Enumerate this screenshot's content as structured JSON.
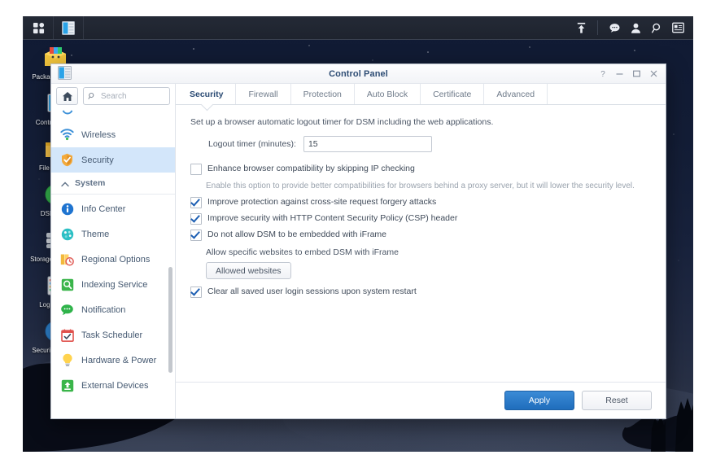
{
  "taskbar": {
    "left_items": [
      {
        "name": "app-menu",
        "icon": "grid-icon"
      },
      {
        "name": "control-panel-task",
        "icon": "control-panel-icon"
      }
    ],
    "right_items": [
      {
        "name": "upload-queue",
        "icon": "upload-icon"
      },
      {
        "name": "notifications",
        "icon": "chat-bubble-icon"
      },
      {
        "name": "user-options",
        "icon": "person-icon"
      },
      {
        "name": "search",
        "icon": "search-icon"
      },
      {
        "name": "widgets",
        "icon": "widget-icon"
      }
    ]
  },
  "desktop_icons": [
    {
      "label": "Package Center",
      "icon": "package-center-icon"
    },
    {
      "label": "Control Panel",
      "icon": "control-panel-icon"
    },
    {
      "label": "File Station",
      "icon": "file-station-icon"
    },
    {
      "label": "DSM Help",
      "icon": "dsm-help-icon"
    },
    {
      "label": "Storage Manager",
      "icon": "storage-manager-icon"
    },
    {
      "label": "Log Center",
      "icon": "log-center-icon"
    },
    {
      "label": "Security Advisor",
      "icon": "security-advisor-icon"
    }
  ],
  "window": {
    "title": "Control Panel",
    "app_icon": "control-panel-icon",
    "controls": [
      {
        "name": "help-button",
        "glyph": "?"
      },
      {
        "name": "minimize-button",
        "glyph": "–"
      },
      {
        "name": "maximize-button",
        "glyph": "□"
      },
      {
        "name": "close-button",
        "glyph": "×"
      }
    ]
  },
  "sidebar": {
    "home_icon": "home-icon",
    "search": {
      "placeholder": "Search",
      "value": "",
      "icon": "search-icon"
    },
    "partial_top_item": {
      "label": "",
      "icon": "network-icon"
    },
    "items": [
      {
        "label": "Wireless",
        "icon": "wireless-icon",
        "selected": false
      },
      {
        "label": "Security",
        "icon": "shield-icon",
        "selected": true
      }
    ],
    "group": {
      "label": "System",
      "icon": "chevron-up-icon",
      "expanded": true
    },
    "system_items": [
      {
        "label": "Info Center",
        "icon": "info-icon"
      },
      {
        "label": "Theme",
        "icon": "palette-icon"
      },
      {
        "label": "Regional Options",
        "icon": "regional-options-icon"
      },
      {
        "label": "Indexing Service",
        "icon": "indexing-service-icon"
      },
      {
        "label": "Notification",
        "icon": "notification-icon"
      },
      {
        "label": "Task Scheduler",
        "icon": "task-scheduler-icon"
      },
      {
        "label": "Hardware & Power",
        "icon": "lightbulb-icon"
      },
      {
        "label": "External Devices",
        "icon": "external-devices-icon"
      }
    ]
  },
  "main": {
    "tabs": [
      {
        "label": "Security",
        "active": true
      },
      {
        "label": "Firewall",
        "active": false
      },
      {
        "label": "Protection",
        "active": false
      },
      {
        "label": "Auto Block",
        "active": false
      },
      {
        "label": "Certificate",
        "active": false
      },
      {
        "label": "Advanced",
        "active": false
      }
    ],
    "intro": "Set up a browser automatic logout timer for DSM including the web applications.",
    "logout_timer": {
      "label": "Logout timer (minutes):",
      "value": "15",
      "placeholder": ""
    },
    "options": [
      {
        "label": "Enhance browser compatibility by skipping IP checking",
        "checked": false,
        "hint": "Enable this option to provide better compatibilities for browsers behind a proxy server, but it will lower the security level."
      },
      {
        "label": "Improve protection against cross-site request forgery attacks",
        "checked": true,
        "hint": ""
      },
      {
        "label": "Improve security with HTTP Content Security Policy (CSP) header",
        "checked": true,
        "hint": ""
      },
      {
        "label": "Do not allow DSM to be embedded with iFrame",
        "checked": true,
        "hint": ""
      }
    ],
    "iframe_sub_text": "Allow specific websites to embed DSM with iFrame",
    "allowed_websites_button": "Allowed websites",
    "last_option": {
      "label": "Clear all saved user login sessions upon system restart",
      "checked": true
    },
    "footer": {
      "apply_label": "Apply",
      "reset_label": "Reset"
    }
  },
  "colors": {
    "accent_blue": "#1f6dbc",
    "selected_sidebar": "#d3e6fa",
    "title_text": "#2e4d74",
    "checkbox_check": "#1d5fb3",
    "taskbar_bg": "#222834"
  }
}
